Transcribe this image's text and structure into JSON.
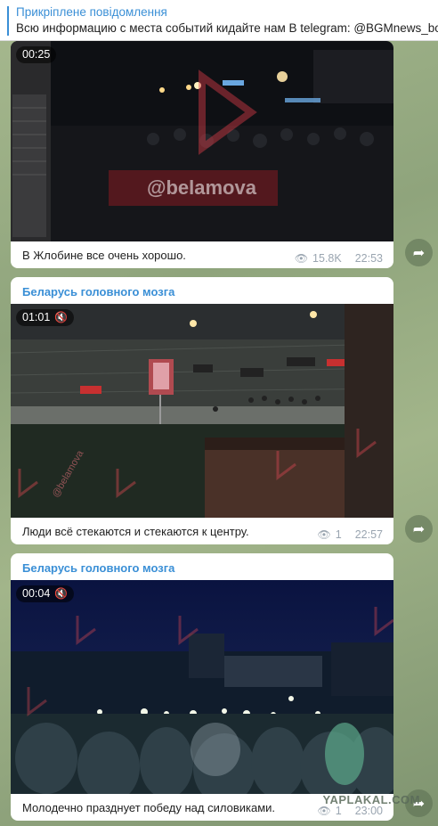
{
  "pinned": {
    "title": "Прикріплене повідомлення",
    "text": "Всю информацию с места событий кидайте нам  В telegram: @BGMnews_bot"
  },
  "messages": [
    {
      "channel": "",
      "duration": "00:25",
      "caption": "В Жлобине все очень хорошо.",
      "views": "15.8K",
      "time": "22:53",
      "watermark": "@belamova"
    },
    {
      "channel": "Беларусь головного мозга",
      "duration": "01:01",
      "caption": "Люди всё стекаются и стекаются к центру.",
      "views": "1",
      "time": "22:57",
      "watermark": "@belamova"
    },
    {
      "channel": "Беларусь головного мозга",
      "duration": "00:04",
      "caption": "Молодечно празднует победу над силовиками.",
      "views": "1",
      "time": "23:00"
    }
  ],
  "site_watermark": "YAPLAKAL.COM",
  "icons": {
    "eye": "eye-icon",
    "share": "share-icon",
    "mute": "mute-icon"
  }
}
